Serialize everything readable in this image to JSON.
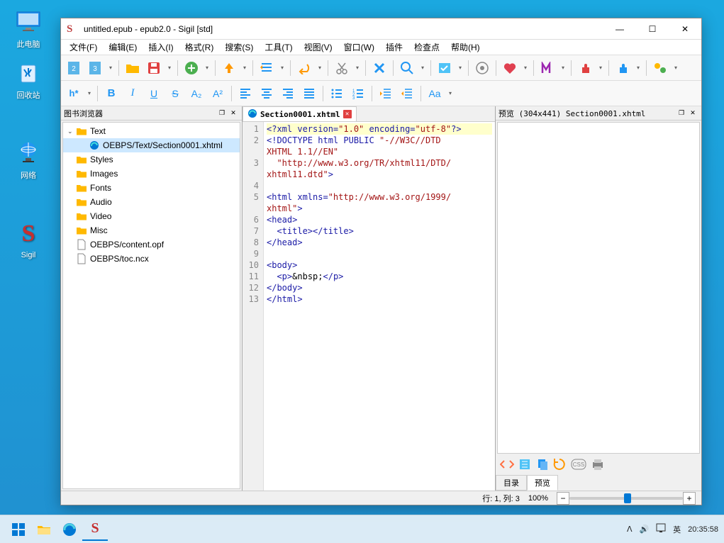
{
  "desktop": {
    "icons": [
      "此电脑",
      "回收站",
      "网络",
      "Sigil"
    ]
  },
  "window": {
    "title": "untitled.epub - epub2.0 - Sigil [std]"
  },
  "menubar": [
    "文件(F)",
    "编辑(E)",
    "插入(I)",
    "格式(R)",
    "搜索(S)",
    "工具(T)",
    "视图(V)",
    "窗口(W)",
    "插件",
    "检查点",
    "帮助(H)"
  ],
  "toolbar1_labels": {
    "h": "h*",
    "bold": "B",
    "italic": "I",
    "underline": "U",
    "strike": "S",
    "sub": "A₂",
    "sup": "A²",
    "aa": "Aa"
  },
  "book_browser": {
    "title": "图书浏览器",
    "tree": [
      {
        "label": "Text",
        "type": "folder",
        "expanded": true,
        "indent": 0
      },
      {
        "label": "OEBPS/Text/Section0001.xhtml",
        "type": "file-html",
        "indent": 1,
        "selected": true
      },
      {
        "label": "Styles",
        "type": "folder",
        "indent": 0
      },
      {
        "label": "Images",
        "type": "folder",
        "indent": 0
      },
      {
        "label": "Fonts",
        "type": "folder",
        "indent": 0
      },
      {
        "label": "Audio",
        "type": "folder",
        "indent": 0
      },
      {
        "label": "Video",
        "type": "folder",
        "indent": 0
      },
      {
        "label": "Misc",
        "type": "folder",
        "indent": 0
      },
      {
        "label": "OEBPS/content.opf",
        "type": "file",
        "indent": 0
      },
      {
        "label": "OEBPS/toc.ncx",
        "type": "file",
        "indent": 0
      }
    ]
  },
  "editor": {
    "tab_name": "Section0001.xhtml",
    "lines": [
      {
        "n": 1,
        "segments": [
          {
            "t": "<?xml version=",
            "c": "tag"
          },
          {
            "t": "\"1.0\"",
            "c": "str"
          },
          {
            "t": " encoding=",
            "c": "tag"
          },
          {
            "t": "\"utf-8\"",
            "c": "str"
          },
          {
            "t": "?>",
            "c": "tag"
          }
        ],
        "hl": true
      },
      {
        "n": 2,
        "segments": [
          {
            "t": "<!DOCTYPE html PUBLIC ",
            "c": "tag"
          },
          {
            "t": "\"-//W3C//DTD ",
            "c": "str"
          }
        ]
      },
      {
        "n": 0,
        "segments": [
          {
            "t": "XHTML 1.1//EN\"",
            "c": "str"
          }
        ]
      },
      {
        "n": 3,
        "segments": [
          {
            "t": "  ",
            "c": "txt"
          },
          {
            "t": "\"http://www.w3.org/TR/xhtml11/DTD/",
            "c": "str"
          }
        ]
      },
      {
        "n": 0,
        "segments": [
          {
            "t": "xhtml11.dtd\"",
            "c": "str"
          },
          {
            "t": ">",
            "c": "tag"
          }
        ]
      },
      {
        "n": 4,
        "segments": []
      },
      {
        "n": 5,
        "segments": [
          {
            "t": "<html xmlns=",
            "c": "tag"
          },
          {
            "t": "\"http://www.w3.org/1999/",
            "c": "str"
          }
        ]
      },
      {
        "n": 0,
        "segments": [
          {
            "t": "xhtml\"",
            "c": "str"
          },
          {
            "t": ">",
            "c": "tag"
          }
        ]
      },
      {
        "n": 6,
        "segments": [
          {
            "t": "<head>",
            "c": "tag"
          }
        ]
      },
      {
        "n": 7,
        "segments": [
          {
            "t": "  ",
            "c": "txt"
          },
          {
            "t": "<title></title>",
            "c": "tag"
          }
        ]
      },
      {
        "n": 8,
        "segments": [
          {
            "t": "</head>",
            "c": "tag"
          }
        ]
      },
      {
        "n": 9,
        "segments": []
      },
      {
        "n": 10,
        "segments": [
          {
            "t": "<body>",
            "c": "tag"
          }
        ]
      },
      {
        "n": 11,
        "segments": [
          {
            "t": "  ",
            "c": "txt"
          },
          {
            "t": "<p>",
            "c": "tag"
          },
          {
            "t": "&nbsp;",
            "c": "txt"
          },
          {
            "t": "</p>",
            "c": "tag"
          }
        ]
      },
      {
        "n": 12,
        "segments": [
          {
            "t": "</body>",
            "c": "tag"
          }
        ]
      },
      {
        "n": 13,
        "segments": [
          {
            "t": "</html>",
            "c": "tag"
          }
        ]
      }
    ]
  },
  "preview": {
    "title": "预览 (304x441) Section0001.xhtml",
    "tabs": [
      "目录",
      "预览"
    ],
    "active_tab": 1,
    "zoom_pct": "100%"
  },
  "status": {
    "cursor": "行: 1, 列: 3"
  },
  "taskbar": {
    "tray": {
      "ime": "英",
      "time": "20:35:58",
      "chevron": "ᐱ",
      "vol": "🕪",
      "lang_pre": "⎚"
    }
  }
}
